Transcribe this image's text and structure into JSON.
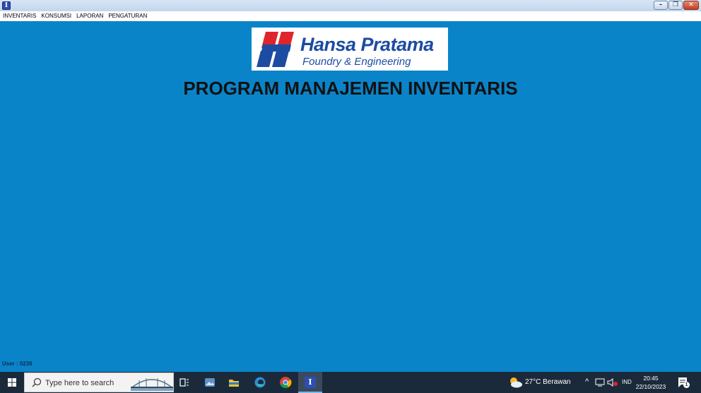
{
  "window": {
    "app_icon": "inventory-app-icon",
    "controls": [
      "minimize-icon",
      "restore-icon",
      "close-icon"
    ]
  },
  "menu": [
    {
      "label": "INVENTARIS"
    },
    {
      "label": "KONSUMSI"
    },
    {
      "label": "LAPORAN"
    },
    {
      "label": "PENGATURAN"
    }
  ],
  "logo": {
    "brand": "Hansa Pratama",
    "tagline": "Foundry & Engineering",
    "colors": {
      "red": "#e0242b",
      "blue": "#1c4ba2"
    }
  },
  "main": {
    "title": "PROGRAM MANAJEMEN INVENTARIS"
  },
  "status": {
    "user": "User : 0236"
  },
  "taskbar": {
    "search_placeholder": "Type here to search",
    "pinned": [
      "task-view-icon",
      "photos-icon",
      "file-explorer-icon",
      "edge-icon",
      "chrome-icon",
      "inventory-app-icon"
    ],
    "weather": "27°C  Berawan",
    "language": "IND",
    "time": "20:45",
    "date": "22/10/2023",
    "notification_count": "1"
  },
  "colors": {
    "background": "#0a84c9",
    "taskbar": "#1b2a3a"
  }
}
